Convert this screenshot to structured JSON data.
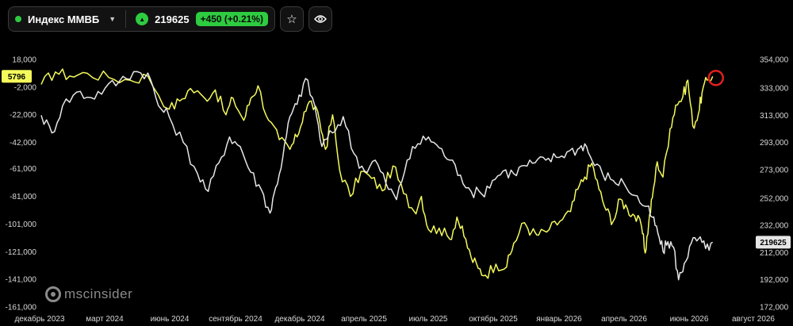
{
  "toolbar": {
    "instrument_name": "Индекс ММВБ",
    "price": "219625",
    "change": "+450 (+0.21%)",
    "up_color": "#2ecc40",
    "status_color": "#2ecc40",
    "icons": [
      "dropdown-chevron",
      "up-arrow",
      "star-outline",
      "eye"
    ]
  },
  "watermark": {
    "text": "mscinsider"
  },
  "chart_data": {
    "type": "line",
    "x_ticks": [
      "декабрь 2023",
      "март 2024",
      "июнь 2024",
      "сентябрь 2024",
      "декабрь 2024",
      "апрель 2025",
      "июль 2025",
      "октябрь 2025",
      "январь 2026",
      "апрель 2026",
      "июнь 2026",
      "август 2026"
    ],
    "left_axis": {
      "ticks": [
        "18,000",
        "-2,000",
        "-22,000",
        "-42,000",
        "-61,000",
        "-81,000",
        "-101,000",
        "-121,000",
        "-141,000",
        "-161,000"
      ],
      "tick_values": [
        18000,
        -2000,
        -22000,
        -42000,
        -61000,
        -81000,
        -101000,
        -121000,
        -141000,
        -161000
      ],
      "range": [
        -161000,
        18000
      ]
    },
    "right_axis": {
      "ticks": [
        "354,000",
        "333,000",
        "313,000",
        "293,000",
        "273,000",
        "252,000",
        "232,000",
        "212,000",
        "192,000",
        "172,000"
      ],
      "tick_values": [
        354000,
        333000,
        313000,
        293000,
        273000,
        252000,
        232000,
        212000,
        192000,
        172000
      ],
      "range": [
        172000,
        354000
      ]
    },
    "grid": false,
    "series": [
      {
        "axis": "left",
        "color": "#f4fa5a",
        "last_value_label": "5796",
        "points": [
          [
            0.0,
            0
          ],
          [
            0.02,
            9000
          ],
          [
            0.04,
            6000
          ],
          [
            0.065,
            8000
          ],
          [
            0.095,
            5000
          ],
          [
            0.125,
            3000
          ],
          [
            0.15,
            6000
          ],
          [
            0.18,
            -18000
          ],
          [
            0.195,
            -12000
          ],
          [
            0.21,
            -3000
          ],
          [
            0.23,
            -10000
          ],
          [
            0.245,
            -4000
          ],
          [
            0.26,
            -22000
          ],
          [
            0.27,
            -10000
          ],
          [
            0.285,
            -26000
          ],
          [
            0.295,
            -10000
          ],
          [
            0.305,
            -1000
          ],
          [
            0.32,
            -26000
          ],
          [
            0.335,
            -40000
          ],
          [
            0.35,
            -47000
          ],
          [
            0.36,
            -38000
          ],
          [
            0.37,
            -20000
          ],
          [
            0.38,
            -12000
          ],
          [
            0.392,
            -27000
          ],
          [
            0.4,
            -47000
          ],
          [
            0.41,
            -22000
          ],
          [
            0.42,
            -62000
          ],
          [
            0.435,
            -81000
          ],
          [
            0.45,
            -63000
          ],
          [
            0.465,
            -68000
          ],
          [
            0.48,
            -77000
          ],
          [
            0.495,
            -59000
          ],
          [
            0.51,
            -79000
          ],
          [
            0.525,
            -92000
          ],
          [
            0.535,
            -81000
          ],
          [
            0.545,
            -105000
          ],
          [
            0.56,
            -104000
          ],
          [
            0.575,
            -112000
          ],
          [
            0.585,
            -96000
          ],
          [
            0.595,
            -110000
          ],
          [
            0.605,
            -125000
          ],
          [
            0.615,
            -133000
          ],
          [
            0.625,
            -138000
          ],
          [
            0.64,
            -130000
          ],
          [
            0.655,
            -132000
          ],
          [
            0.665,
            -115000
          ],
          [
            0.68,
            -100000
          ],
          [
            0.69,
            -107000
          ],
          [
            0.7,
            -109000
          ],
          [
            0.715,
            -105000
          ],
          [
            0.73,
            -99000
          ],
          [
            0.745,
            -92000
          ],
          [
            0.755,
            -76000
          ],
          [
            0.765,
            -67000
          ],
          [
            0.775,
            -57000
          ],
          [
            0.785,
            -76000
          ],
          [
            0.795,
            -91000
          ],
          [
            0.805,
            -99000
          ],
          [
            0.815,
            -83000
          ],
          [
            0.825,
            -90000
          ],
          [
            0.835,
            -95000
          ],
          [
            0.845,
            -103000
          ],
          [
            0.85,
            -122000
          ],
          [
            0.855,
            -100000
          ],
          [
            0.86,
            -82000
          ],
          [
            0.867,
            -56000
          ],
          [
            0.875,
            -67000
          ],
          [
            0.885,
            -32000
          ],
          [
            0.893,
            -15000
          ],
          [
            0.903,
            -9000
          ],
          [
            0.91,
            3000
          ],
          [
            0.917,
            -30000
          ],
          [
            0.925,
            -21000
          ],
          [
            0.93,
            -6000
          ],
          [
            0.937,
            3000
          ],
          [
            0.945,
            5796
          ]
        ]
      },
      {
        "axis": "right",
        "color": "#e6e6e6",
        "last_value_label": "219625",
        "points": [
          [
            0.0,
            313000
          ],
          [
            0.015,
            300000
          ],
          [
            0.03,
            320000
          ],
          [
            0.05,
            330000
          ],
          [
            0.07,
            326000
          ],
          [
            0.09,
            333000
          ],
          [
            0.11,
            338000
          ],
          [
            0.13,
            345000
          ],
          [
            0.15,
            344000
          ],
          [
            0.165,
            320000
          ],
          [
            0.18,
            312000
          ],
          [
            0.2,
            293000
          ],
          [
            0.22,
            270000
          ],
          [
            0.235,
            257000
          ],
          [
            0.25,
            278000
          ],
          [
            0.265,
            297000
          ],
          [
            0.28,
            290000
          ],
          [
            0.295,
            271000
          ],
          [
            0.31,
            258000
          ],
          [
            0.322,
            241000
          ],
          [
            0.33,
            260000
          ],
          [
            0.34,
            282000
          ],
          [
            0.35,
            312000
          ],
          [
            0.36,
            321000
          ],
          [
            0.372,
            340000
          ],
          [
            0.385,
            320000
          ],
          [
            0.395,
            290000
          ],
          [
            0.41,
            300000
          ],
          [
            0.425,
            312000
          ],
          [
            0.44,
            285000
          ],
          [
            0.455,
            272000
          ],
          [
            0.47,
            280000
          ],
          [
            0.485,
            263000
          ],
          [
            0.5,
            251000
          ],
          [
            0.515,
            280000
          ],
          [
            0.53,
            292000
          ],
          [
            0.545,
            297000
          ],
          [
            0.56,
            289000
          ],
          [
            0.575,
            280000
          ],
          [
            0.59,
            269000
          ],
          [
            0.605,
            257000
          ],
          [
            0.62,
            255000
          ],
          [
            0.635,
            265000
          ],
          [
            0.65,
            272000
          ],
          [
            0.665,
            270000
          ],
          [
            0.68,
            276000
          ],
          [
            0.695,
            278000
          ],
          [
            0.71,
            280000
          ],
          [
            0.725,
            282000
          ],
          [
            0.74,
            286000
          ],
          [
            0.755,
            288000
          ],
          [
            0.765,
            292000
          ],
          [
            0.775,
            280000
          ],
          [
            0.79,
            270000
          ],
          [
            0.805,
            265000
          ],
          [
            0.82,
            263000
          ],
          [
            0.835,
            254000
          ],
          [
            0.85,
            246000
          ],
          [
            0.86,
            238000
          ],
          [
            0.868,
            226000
          ],
          [
            0.875,
            213000
          ],
          [
            0.882,
            220000
          ],
          [
            0.89,
            216000
          ],
          [
            0.897,
            192000
          ],
          [
            0.905,
            204000
          ],
          [
            0.915,
            219000
          ],
          [
            0.925,
            222000
          ],
          [
            0.935,
            215000
          ],
          [
            0.945,
            219625
          ]
        ]
      }
    ],
    "annotation": {
      "type": "circle",
      "color": "#e02020",
      "note": "marks latest point"
    }
  }
}
